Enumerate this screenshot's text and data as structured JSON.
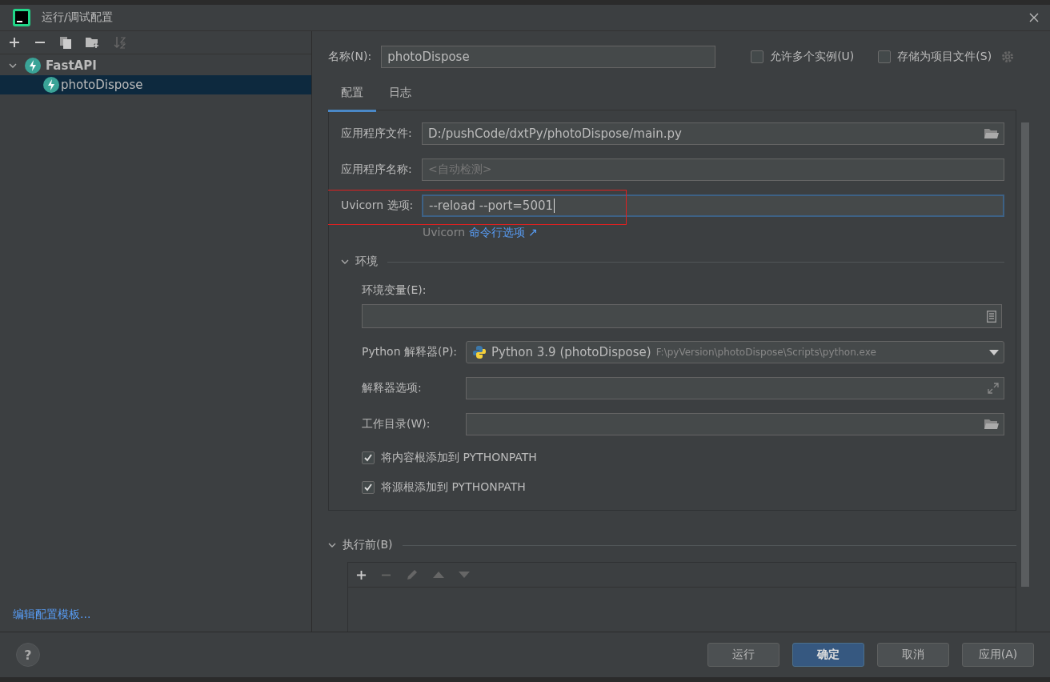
{
  "window": {
    "title": "运行/调试配置"
  },
  "tree": [
    {
      "label": "FastAPI",
      "expanded": true,
      "selected": false,
      "children": [
        {
          "label": "photoDispose",
          "selected": true
        }
      ]
    }
  ],
  "edit_templates_link": "编辑配置模板...",
  "help_button": "?",
  "name_field": {
    "label": "名称(N):",
    "value": "photoDispose"
  },
  "options": [
    {
      "label": "允许多个实例(U)",
      "checked": false
    },
    {
      "label": "存储为项目文件(S)",
      "checked": false
    }
  ],
  "tabs": [
    {
      "label": "配置",
      "selected": true
    },
    {
      "label": "日志",
      "selected": false
    }
  ],
  "fields": [
    {
      "kind": "browse",
      "label": "应用程序文件:",
      "value": "D:/pushCode/dxtPy/photoDispose/main.py",
      "focused": false,
      "highlighted": false
    },
    {
      "kind": "text",
      "label": "应用程序名称:",
      "placeholder": "<自动检测>",
      "focused": false,
      "highlighted": false
    },
    {
      "kind": "text",
      "label": "Uvicorn 选项:",
      "value": "--reload --port=5001",
      "focused": true,
      "highlighted": true
    }
  ],
  "uvicorn_hint": {
    "text": "Uvicorn",
    "link": "命令行选项 ↗"
  },
  "environment": {
    "title": "环境",
    "expanded": true,
    "env_vars": {
      "label": "环境变量(E):"
    },
    "interpreter": {
      "label": "Python 解释器(P):",
      "name": "Python 3.9 (photoDispose)",
      "path": "F:\\pyVersion\\photoDispose\\Scripts\\python.exe"
    },
    "interpreter_options": {
      "label": "解释器选项:"
    },
    "working_dir": {
      "label": "工作目录(W):"
    },
    "checkboxes": [
      {
        "label": "将内容根添加到 PYTHONPATH",
        "checked": true
      },
      {
        "label": "将源根添加到 PYTHONPATH",
        "checked": true
      }
    ]
  },
  "before_launch": {
    "title": "执行前(B)",
    "expanded": true
  },
  "buttons": [
    {
      "label": "运行",
      "primary": false
    },
    {
      "label": "确定",
      "primary": true
    },
    {
      "label": "取消",
      "primary": false
    },
    {
      "label": "应用(A)",
      "primary": false
    }
  ]
}
